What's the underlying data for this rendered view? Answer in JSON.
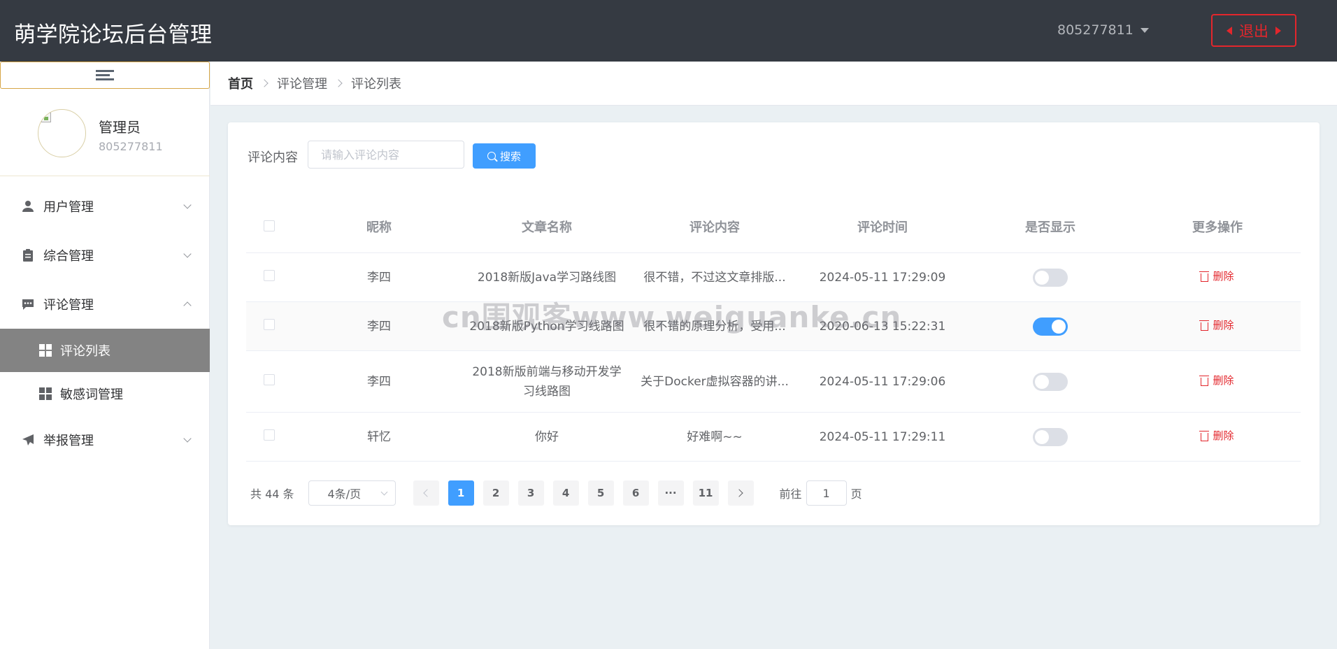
{
  "header": {
    "title": "萌学院论坛后台管理",
    "user": "805277811",
    "logout_label": "退出"
  },
  "sidebar": {
    "profile": {
      "name": "管理员",
      "id": "805277811"
    },
    "menu": [
      {
        "label": "用户管理",
        "icon": "user-icon",
        "expanded": false
      },
      {
        "label": "综合管理",
        "icon": "clipboard-icon",
        "expanded": false
      },
      {
        "label": "评论管理",
        "icon": "comment-icon",
        "expanded": true,
        "children": [
          {
            "label": "评论列表",
            "active": true
          },
          {
            "label": "敏感词管理",
            "active": false
          }
        ]
      },
      {
        "label": "举报管理",
        "icon": "send-icon",
        "expanded": false
      }
    ]
  },
  "breadcrumb": {
    "home": "首页",
    "level1": "评论管理",
    "level2": "评论列表"
  },
  "filter": {
    "label": "评论内容",
    "placeholder": "请输入评论内容",
    "value": "",
    "search_label": "搜索"
  },
  "table": {
    "columns": [
      "昵称",
      "文章名称",
      "评论内容",
      "评论时间",
      "是否显示",
      "更多操作"
    ],
    "rows": [
      {
        "nickname": "李四",
        "article": "2018新版Java学习路线图",
        "content": "很不错，不过这文章排版...",
        "time": "2024-05-11 17:29:09",
        "shown": false,
        "action": "删除"
      },
      {
        "nickname": "李四",
        "article": "2018新版Python学习线路图",
        "content": "很不错的原理分析，受用...",
        "time": "2020-06-13 15:22:31",
        "shown": true,
        "action": "删除"
      },
      {
        "nickname": "李四",
        "article": "2018新版前端与移动开发学习线路图",
        "content": "关于Docker虚拟容器的讲...",
        "time": "2024-05-11 17:29:06",
        "shown": false,
        "action": "删除"
      },
      {
        "nickname": "轩忆",
        "article": "你好",
        "content": "好难啊~~",
        "time": "2024-05-11 17:29:11",
        "shown": false,
        "action": "删除"
      }
    ]
  },
  "pagination": {
    "total_text": "共 44 条",
    "page_size": "4条/页",
    "pages": [
      "1",
      "2",
      "3",
      "4",
      "5",
      "6",
      "···",
      "11"
    ],
    "current": "1",
    "goto_label": "前往",
    "goto_value": "1",
    "goto_suffix": "页"
  },
  "watermark": "cn围观客www.weiguanke.cn",
  "colors": {
    "primary": "#409eff",
    "danger": "#e3262c",
    "header_bg": "#353a42",
    "active_menu_bg": "#838383"
  }
}
